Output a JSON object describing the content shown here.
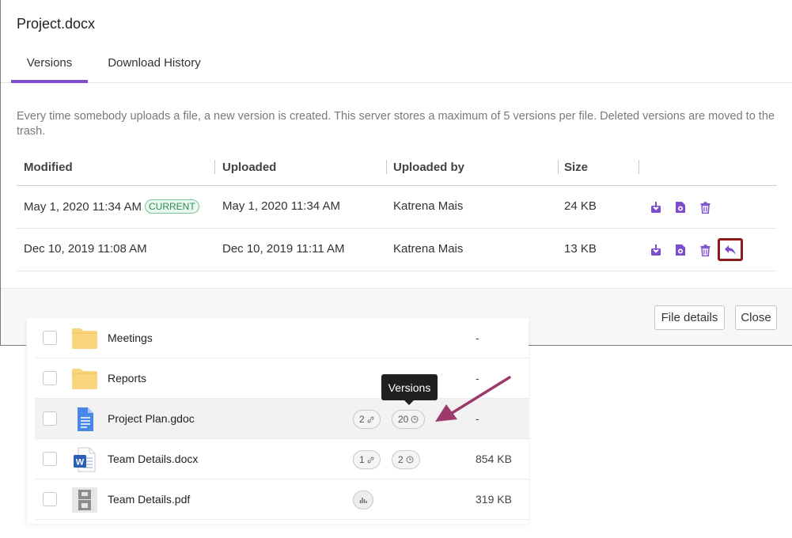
{
  "dialog": {
    "title": "Project.docx",
    "tabs": [
      {
        "label": "Versions",
        "active": true
      },
      {
        "label": "Download History",
        "active": false
      }
    ],
    "description": "Every time somebody uploads a file, a new version is created. This server stores a maximum of 5 versions per file. Deleted versions are moved to the trash.",
    "columns": [
      "Modified",
      "Uploaded",
      "Uploaded by",
      "Size"
    ],
    "rows": [
      {
        "modified": "May 1, 2020 11:34 AM",
        "badge": "CURRENT",
        "uploaded": "May 1, 2020 11:34 AM",
        "by": "Katrena Mais",
        "size": "24 KB"
      },
      {
        "modified": "Dec 10, 2019 11:08 AM",
        "badge": "",
        "uploaded": "Dec 10, 2019 11:11 AM",
        "by": "Katrena Mais",
        "size": "13 KB"
      }
    ],
    "buttons": {
      "details": "File details",
      "close": "Close"
    },
    "colors": {
      "accent": "#7c4dcc",
      "action_icon": "#7c4dcc",
      "highlight_box": "#8b1a1a",
      "current_badge": "#2e8b57"
    }
  },
  "files": {
    "rows": [
      {
        "name": "Meetings",
        "icon": "folder-icon",
        "links": "",
        "versions": "",
        "size": "-"
      },
      {
        "name": "Reports",
        "icon": "folder-icon",
        "links": "",
        "versions": "",
        "size": "-"
      },
      {
        "name": "Project Plan.gdoc",
        "icon": "google-doc-icon",
        "links": "2",
        "versions": "20",
        "size": "-"
      },
      {
        "name": "Team Details.docx",
        "icon": "word-doc-icon",
        "links": "1",
        "versions": "2",
        "size": "854 KB"
      },
      {
        "name": "Team Details.pdf",
        "icon": "pdf-thumbnail-icon",
        "links": "",
        "versions": "",
        "size": "319 KB"
      }
    ],
    "tooltip": "Versions",
    "colors": {
      "annotation_arrow": "#9b3a6b",
      "folder": "#f8d57e"
    }
  }
}
